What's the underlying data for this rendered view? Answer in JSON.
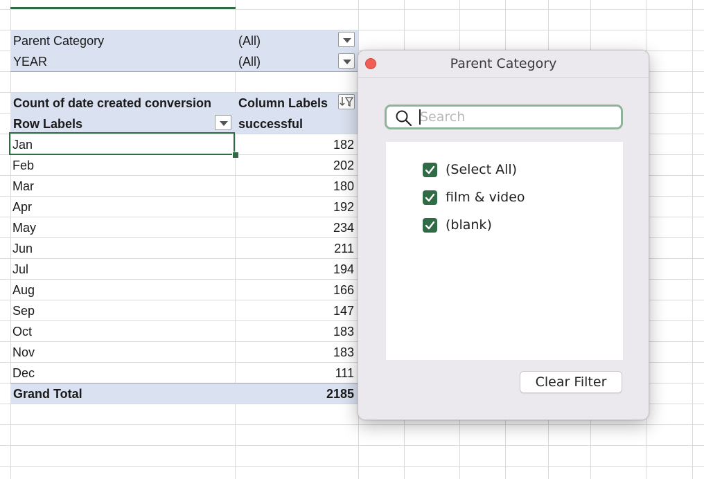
{
  "filters": [
    {
      "label": "Parent Category",
      "value": "(All)"
    },
    {
      "label": "YEAR",
      "value": "(All)"
    }
  ],
  "pivot": {
    "value_header": "Count of date created conversion",
    "column_labels": "Column Labels",
    "row_labels": "Row Labels",
    "column_value": "successful",
    "rows": [
      {
        "label": "Jan",
        "value": "182"
      },
      {
        "label": "Feb",
        "value": "202"
      },
      {
        "label": "Mar",
        "value": "180"
      },
      {
        "label": "Apr",
        "value": "192"
      },
      {
        "label": "May",
        "value": "234"
      },
      {
        "label": "Jun",
        "value": "211"
      },
      {
        "label": "Jul",
        "value": "194"
      },
      {
        "label": "Aug",
        "value": "166"
      },
      {
        "label": "Sep",
        "value": "147"
      },
      {
        "label": "Oct",
        "value": "183"
      },
      {
        "label": "Nov",
        "value": "183"
      },
      {
        "label": "Dec",
        "value": "111"
      }
    ],
    "grand_total_label": "Grand Total",
    "grand_total_value": "2185"
  },
  "popup": {
    "title": "Parent Category",
    "search_placeholder": "Search",
    "options": [
      {
        "label": "(Select All)",
        "checked": true
      },
      {
        "label": "film & video",
        "checked": true
      },
      {
        "label": "(blank)",
        "checked": true
      }
    ],
    "clear_filter": "Clear Filter"
  },
  "colors": {
    "accent": "#2f6b45",
    "pivot_band": "#dae1f0",
    "close": "#ee5d56"
  },
  "icons": [
    "dropdown-arrow-icon",
    "filter-sort-icon",
    "search-icon",
    "checkmark-icon",
    "close-icon"
  ]
}
